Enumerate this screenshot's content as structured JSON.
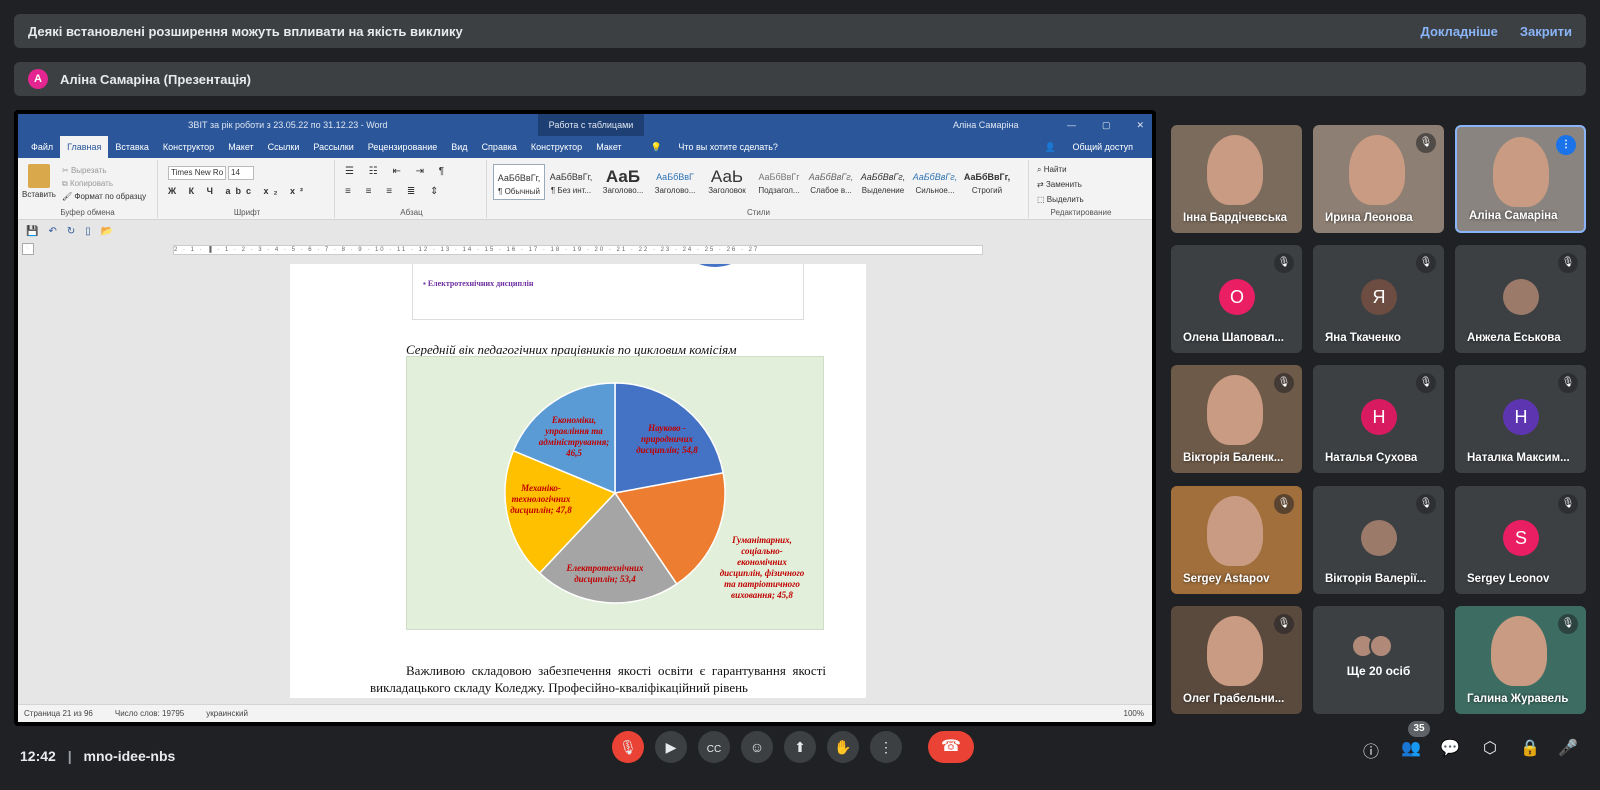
{
  "banner": {
    "message": "Деякі встановлені розширення можуть впливати на якість виклику",
    "more_link": "Докладніше",
    "close_link": "Закрити"
  },
  "presenter": {
    "initial": "А",
    "label": "Аліна Самаріна (Презентація)",
    "color": "#e52592"
  },
  "word": {
    "doc_title": "ЗВІТ за рік роботи з 23.05.22 по 31.12.23  -  Word",
    "context_tab": "Работа с таблицами",
    "user": "Аліна Самаріна",
    "tabs": [
      "Файл",
      "Главная",
      "Вставка",
      "Конструктор",
      "Макет",
      "Ссылки",
      "Рассылки",
      "Рецензирование",
      "Вид",
      "Справка",
      "Конструктор",
      "Макет"
    ],
    "tell_me": "Что вы хотите сделать?",
    "share": "Общий доступ",
    "clipboard": {
      "paste": "Вставить",
      "cut": "Вырезать",
      "copy": "Копировать",
      "format": "Формат по образцу",
      "label": "Буфер обмена"
    },
    "font": {
      "name": "Times New Ro",
      "size": "14",
      "label": "Шрифт",
      "format_row": "Ж К Ч abc x₂ x²"
    },
    "paragraph": {
      "label": "Абзац"
    },
    "styles": {
      "label": "Стили",
      "items": [
        {
          "sample": "АаБбВвГг,",
          "name": "¶ Обычный"
        },
        {
          "sample": "АаБбВвГг,",
          "name": "¶ Без инт..."
        },
        {
          "sample": "АаБ",
          "name": "Заголово..."
        },
        {
          "sample": "АаБбВвГ",
          "name": "Заголово..."
        },
        {
          "sample": "АаЬ",
          "name": "Заголовок"
        },
        {
          "sample": "АаБбВвГг",
          "name": "Подзагол..."
        },
        {
          "sample": "АаБбВвГг,",
          "name": "Слабое в..."
        },
        {
          "sample": "АаБбВвГг,",
          "name": "Выделение"
        },
        {
          "sample": "АаБбВвГг,",
          "name": "Сильное..."
        },
        {
          "sample": "АаБбВвГг,",
          "name": "Строгий"
        }
      ]
    },
    "editing": {
      "find": "Найти",
      "replace": "Заменить",
      "select": "Выделить",
      "label": "Редактирование"
    },
    "ruler_text": "2 · 1 · ▐ · 1 · 2 · 3 · 4 · 5 · 6 · 7 · 8 · 9 · 10 · 11 · 12 · 13 · 14 · 15 · 16 · 17 · 18 · 19 · 20 · 21 · 22 · 23 · 24 · 25 · 26 · 27",
    "prev_legend": "▪ Електротехнічних дисциплін",
    "body_text": "Важливою складовою забезпечення якості освіти є гарантування якості викладацького складу Коледжу. Професійно-кваліфікаційний рівень",
    "status": {
      "page": "Страница 21 из 96",
      "words": "Число слов: 19795",
      "lang": "украинский",
      "zoom": "100%"
    }
  },
  "chart_data": {
    "type": "pie",
    "title": "Середній вік педагогічних працівників по цикловим комісіям",
    "slices": [
      {
        "label": "Науково - природничих дисциплін; 54,8",
        "value": 54.8,
        "color": "#4472c4"
      },
      {
        "label": "Гуманітарних, соціально-економічних дисциплін, фізичного та патріотичного виховання; 45,8",
        "value": 45.8,
        "color": "#ed7d31"
      },
      {
        "label": "Електротехнічних дисциплін; 53,4",
        "value": 53.4,
        "color": "#a5a5a5"
      },
      {
        "label": "Механіко-технологічних дисциплін; 47,8",
        "value": 47.8,
        "color": "#ffc000"
      },
      {
        "label": "Економіки, управління та адміністрування; 46,5",
        "value": 46.5,
        "color": "#5b9bd5"
      }
    ],
    "label_color": "#c00000",
    "background": "#e2efda"
  },
  "participants": [
    {
      "name": "Інна Бардічевська",
      "type": "video",
      "muted": false
    },
    {
      "name": "Ирина Леонова",
      "type": "video",
      "muted": true
    },
    {
      "name": "Аліна Самаріна",
      "type": "video",
      "muted": false,
      "speaking": true
    },
    {
      "name": "Олена Шаповал...",
      "type": "avatar",
      "initial": "О",
      "color": "#e91e63",
      "muted": true
    },
    {
      "name": "Яна Ткаченко",
      "type": "avatar",
      "initial": "Я",
      "color": "#6d4c41",
      "muted": true
    },
    {
      "name": "Анжела Еськова",
      "type": "photo",
      "muted": true
    },
    {
      "name": "Вікторія Баленк...",
      "type": "video",
      "muted": true
    },
    {
      "name": "Наталья Сухова",
      "type": "avatar",
      "initial": "Н",
      "color": "#d81b60",
      "muted": true
    },
    {
      "name": "Наталка Максим...",
      "type": "avatar",
      "initial": "Н",
      "color": "#5e35b1",
      "muted": true
    },
    {
      "name": "Sergey Astapov",
      "type": "video",
      "muted": true
    },
    {
      "name": "Вікторія Валерії...",
      "type": "photo",
      "muted": true
    },
    {
      "name": "Sergey Leonov",
      "type": "avatar",
      "initial": "S",
      "color": "#e91e63",
      "muted": true
    },
    {
      "name": "Олег Грабельни...",
      "type": "video",
      "muted": true
    },
    {
      "name": "Ще 20 осіб",
      "type": "more",
      "muted": false
    },
    {
      "name": "Галина Журавель",
      "type": "video",
      "muted": true
    }
  ],
  "bottom": {
    "time": "12:42",
    "separator": "|",
    "meeting_code": "mno-idee-nbs",
    "participant_count": "35"
  }
}
